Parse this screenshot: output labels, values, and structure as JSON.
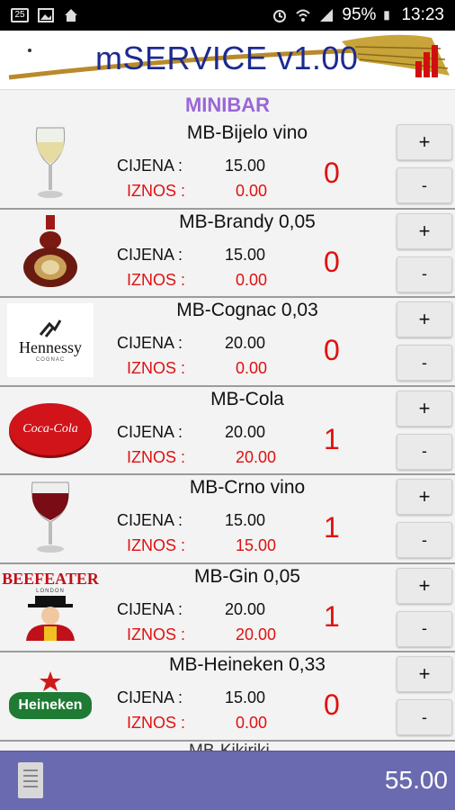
{
  "status_bar": {
    "battery": "95%",
    "time": "13:23",
    "icons": [
      "sim-icon",
      "image-icon",
      "home-icon",
      "alarm-icon",
      "wifi-icon",
      "signal-icon",
      "battery-icon"
    ]
  },
  "header": {
    "title": "mSERVICE v1.00",
    "menu_icon": "dots-icon",
    "chart_icon": "bar-chart-icon"
  },
  "section": {
    "title": "MINIBAR"
  },
  "labels": {
    "price": "CIJENA :",
    "amount": "IZNOS :"
  },
  "items": [
    {
      "name": "MB-Bijelo vino",
      "price": "15.00",
      "amount": "0.00",
      "qty": "0",
      "image": "white-wine-glass",
      "plus": "+",
      "minus": "-"
    },
    {
      "name": "MB-Brandy 0,05",
      "price": "15.00",
      "amount": "0.00",
      "qty": "0",
      "image": "brandy-bottle",
      "plus": "+",
      "minus": "-"
    },
    {
      "name": "MB-Cognac 0,03",
      "price": "20.00",
      "amount": "0.00",
      "qty": "0",
      "image": "hennessy-logo",
      "plus": "+",
      "minus": "-"
    },
    {
      "name": "MB-Cola",
      "price": "20.00",
      "amount": "20.00",
      "qty": "1",
      "image": "coca-cola-cap",
      "plus": "+",
      "minus": "-"
    },
    {
      "name": "MB-Crno vino",
      "price": "15.00",
      "amount": "15.00",
      "qty": "1",
      "image": "red-wine-glass",
      "plus": "+",
      "minus": "-"
    },
    {
      "name": "MB-Gin 0,05",
      "price": "20.00",
      "amount": "20.00",
      "qty": "1",
      "image": "beefeater-logo",
      "plus": "+",
      "minus": "-"
    },
    {
      "name": "MB-Heineken 0,33",
      "price": "15.00",
      "amount": "0.00",
      "qty": "0",
      "image": "heineken-logo",
      "plus": "+",
      "minus": "-"
    }
  ],
  "peek_item": "MB-Kikiriki",
  "footer": {
    "total": "55.00",
    "receipt_icon": "receipt-icon"
  },
  "logos": {
    "hennessy": "Hennessy",
    "hennessy_sub": "COGNAC",
    "coca_cola": "Coca-Cola",
    "beefeater": "BEEFEATER",
    "beefeater_sub": "LONDON",
    "heineken": "Heineken"
  }
}
